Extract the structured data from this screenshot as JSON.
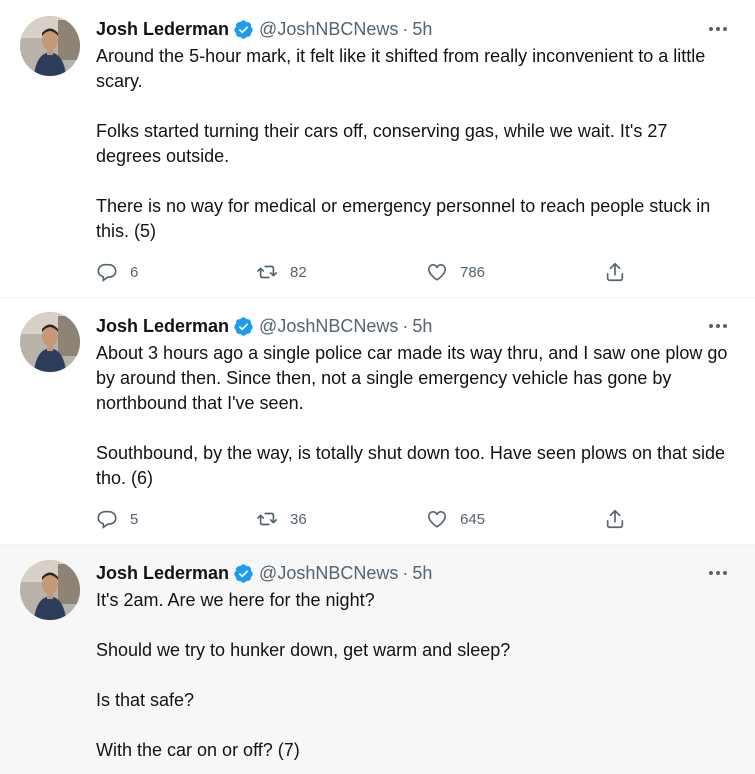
{
  "tweets": [
    {
      "author": {
        "name": "Josh Lederman",
        "handle": "@JoshNBCNews",
        "verified": true
      },
      "separator": "·",
      "time": "5h",
      "paragraphs": [
        "Around the 5-hour mark, it felt like it shifted from really inconvenient to a little scary.",
        "Folks started turning their cars off, conserving gas, while we wait. It's 27 degrees outside.",
        "There is no way for medical or emergency personnel to reach people stuck in this. (5)"
      ],
      "stats": {
        "replies": "6",
        "retweets": "82",
        "likes": "786"
      }
    },
    {
      "author": {
        "name": "Josh Lederman",
        "handle": "@JoshNBCNews",
        "verified": true
      },
      "separator": "·",
      "time": "5h",
      "paragraphs": [
        "About 3 hours ago a single police car made its way thru, and I saw one plow go by around then. Since then, not a single emergency vehicle has gone by northbound that I've seen.",
        "Southbound, by the way, is totally shut down too. Have seen plows on that side tho. (6)"
      ],
      "stats": {
        "replies": "5",
        "retweets": "36",
        "likes": "645"
      }
    },
    {
      "author": {
        "name": "Josh Lederman",
        "handle": "@JoshNBCNews",
        "verified": true
      },
      "separator": "·",
      "time": "5h",
      "paragraphs": [
        "It's 2am. Are we here for the night?",
        "Should we try to hunker down, get warm and sleep?",
        "Is that safe?",
        "With the car on or off? (7)"
      ]
    }
  ],
  "icons": {
    "verified": "verified-badge-icon",
    "more": "more-dots-icon",
    "reply": "reply-icon",
    "retweet": "retweet-icon",
    "like": "heart-icon",
    "share": "share-icon"
  },
  "colors": {
    "text": "#0f1419",
    "secondary": "#536471",
    "verified": "#1d9bf0",
    "hover_background": "#f7f7f7",
    "divider": "#eff3f4"
  }
}
